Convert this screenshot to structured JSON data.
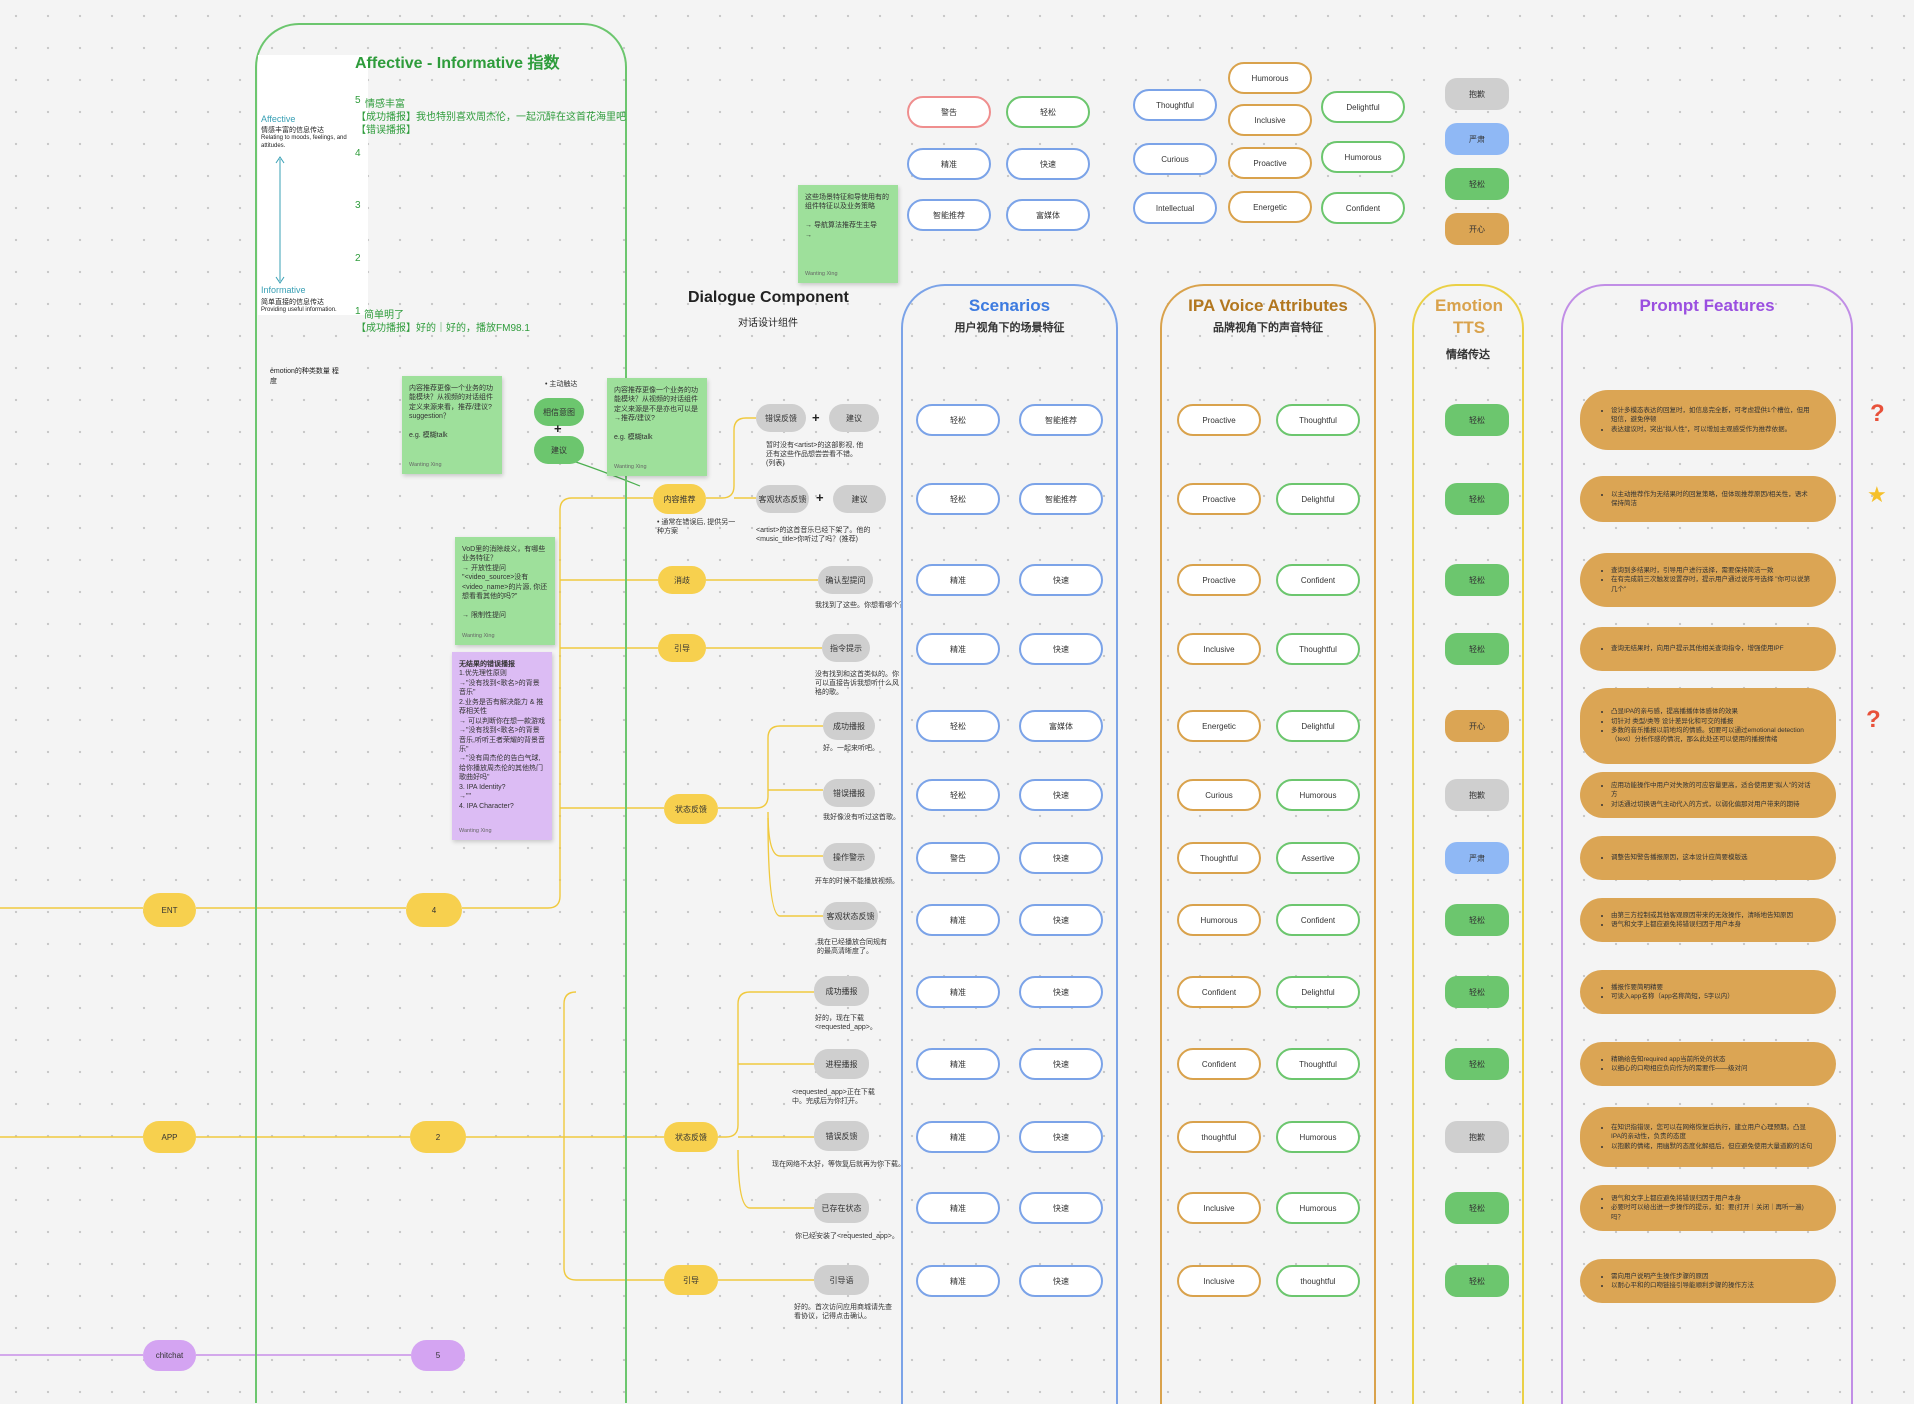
{
  "palette": {
    "yellow": "#f7d04e",
    "green_lane": "#6cc66e",
    "blue_lane": "#7ba3e8",
    "orange_lane": "#d9a24c",
    "gold_lane": "#ead046",
    "purple_lane": "#c18ee6",
    "red": "#e8513a"
  },
  "affective": {
    "title": "Affective - Informative 指数",
    "top_label": "Affective",
    "top_desc1": "情感丰富的信息传达",
    "top_desc2": "Relating to moods, feelings, and attitudes.",
    "bottom_label": "Informative",
    "bottom_desc1": "简单直接的信息传达",
    "bottom_desc2": "Providing useful information.",
    "level5_num": "5",
    "level5_title": "情感丰富",
    "level5_line1": "【成功播报】我也特别喜欢周杰伦，一起沉醉在这首花海里吧",
    "level5_line2": "【错误播报】",
    "level4": "4",
    "level3": "3",
    "level2": "2",
    "level1_num": "1",
    "level1_title": "简单明了",
    "level1_line1": "【成功播报】好的｜好的，播放FM98.1",
    "emotion_note": "emotion的种类数量 程度"
  },
  "dialogue": {
    "title": "Dialogue Component",
    "subtitle": "对话设计组件"
  },
  "notes": {
    "n1": "内容推荐更像一个业务的功能模块？从视频的对话组件定义来源来看，推荐/建议?suggestion？\n\ne.g. 模糊talk",
    "n1_author": "Wanting Xing",
    "n2": "内容推荐更像一个业务的功能模块？从视频的对话组件定义来源是不是亦也可以是→推荐/建议?\n\ne.g. 模糊talk",
    "n2_author": "Wanting Xing",
    "n3": "这些场景特征和导使用有的组件特征以及业务策略\n\n→ 导航算法推荐生主导\n→",
    "n3_author": "Wanting Xing",
    "n4": "VoD里的消除歧义，有哪些业务特征？\n→ 开放性提问\n\"<video_source>没有<video_name>的片源, 你还想看看其他的吗?\"\n\n→ 限制性提问",
    "n4_author": "Wanting Xing",
    "n5_title": "无结果的错误播报",
    "n5": "1.优先理性原则\n→\"没有找到<歌名>的背景音乐\"\n2.业务是否有解决能力 & 推荐相关性\n→ 可以判断你在想一款游戏\n→\"没有找到<歌名>的背景音乐,听听王者荣耀的背景音乐\"\n→\"没有周杰伦的告白气球, 给你播放周杰伦的其他热门歌曲好吗\"\n3. IPA Identity?\n→\"\"\n4. IPA Character?",
    "n5_author": "Wanting Xing"
  },
  "small_nodes": {
    "active": "• 主动触达",
    "intent": "相信意图",
    "plus": "+",
    "suggest": "建议",
    "content_recommend": "内容推荐",
    "content_caption": "• 通常在错误后, 提供另一种方案",
    "rc_fail": "错误反馈",
    "rc_suggest": "建议",
    "rc_caption": "暂时没有<artist>的这部影视, 他还有这些作品想尝尝看不错。(列表)",
    "rc2_fail": "客观状态反馈",
    "rc2_suggest": "建议",
    "rc2_caption": "<artist>的这首音乐已经下架了。他的<music_title>你听过了吗？(推荐)",
    "disambig": "消歧",
    "confirm": "确认型提问",
    "confirm_caption": "我找到了这些。你想看哪个？",
    "guide": "引导",
    "guide_tip": "指令提示",
    "guide_caption": "没有找到和这首类似的。你可以直接告诉我想听什么风格的歌。",
    "status": "状态反馈",
    "s1": "成功播报",
    "s1_caption": "好。一起来听吧。",
    "s2": "错误播报",
    "s2_caption": "我好像没有听过这首歌。",
    "s3": "操作警示",
    "s3_caption": "开车的时候不能播放视频。",
    "s4": "客观状态反馈",
    "s4_caption": "我在已经播放合同规有的最高清晰度了。",
    "a1": "成功播报",
    "a1_caption": "好的，现在下载<requested_app>。",
    "a2": "进程播报",
    "a2_caption": "<requested_app>正在下载中。完成后为你打开。",
    "a3": "错误反馈",
    "a3_caption": "现在网络不太好，等恢复后就再为你下载。",
    "a4": "已存在状态",
    "a4_caption": "你已经安装了<requested_app>。",
    "a_status": "状态反馈",
    "a_guide": "引导",
    "a5": "引导语",
    "a5_caption": "好的。首次访问应用商城请先查看协议，记得点击确认。",
    "ent": "ENT",
    "ent_num": "4",
    "app": "APP",
    "app_num": "2",
    "chitchat": "chitchat",
    "chitchat_num": "5"
  },
  "legend_pills": {
    "red1": "警告",
    "green1": "轻松",
    "blue1": "精准",
    "blue2": "快速",
    "blue3": "智能推荐",
    "blue4": "富媒体",
    "voice": [
      "Thoughtful",
      "Curious",
      "Intellectual",
      "Humorous",
      "Inclusive",
      "Proactive",
      "Energetic",
      "Delightful",
      "Humorous",
      "Confident"
    ],
    "emo": [
      "抱歉",
      "严肃",
      "轻松",
      "开心"
    ]
  },
  "lanes": {
    "scenarios_title": "Scenarios",
    "scenarios_sub": "用户视角下的场景特征",
    "ipa_title": "IPA Voice Attributes",
    "ipa_sub": "品牌视角下的声音特征",
    "emotion_title": "Emotion TTS",
    "emotion_sub": "情绪传达",
    "prompt_title": "Prompt Features"
  },
  "rows": [
    {
      "s1": "轻松",
      "s2": "智能推荐",
      "v1": "Proactive",
      "v2": "Thoughtful",
      "emo": "轻松",
      "pf": [
        "设计多模态表达的回复时，如信息完全断，可考虑提供1个槽位，但用短信，避免停顿",
        "表达建议时，突出\"拟人性\"，可以增加主观感受作为推荐依据。"
      ]
    },
    {
      "s1": "轻松",
      "s2": "智能推荐",
      "v1": "Proactive",
      "v2": "Delightful",
      "emo": "轻松",
      "pf": [
        "以主动推荐作为无结果时的回复策略，但体现推荐原因/相关性，语术保持简洁"
      ]
    },
    {
      "s1": "精准",
      "s2": "快速",
      "v1": "Proactive",
      "v2": "Confident",
      "emo": "轻松",
      "pf": [
        "查询到多结果时，引导用户进行选择，需要保持简洁一致",
        "在有完成前三次触发设置存时，提示用户通过说序号选择 \"你可以说第几个\""
      ]
    },
    {
      "s1": "精准",
      "s2": "快速",
      "v1": "Inclusive",
      "v2": "Thoughtful",
      "emo": "轻松",
      "pf": [
        "查询无结果时，向用户提示其他相关查询指令，增强使用IPF"
      ]
    },
    {
      "s1": "轻松",
      "s2": "富媒体",
      "v1": "Energetic",
      "v2": "Delightful",
      "emo": "开心",
      "pf": [
        "凸显IPA的亲与感，提高播播体体感体的效果",
        "切针对 类型/类等 设计差异化和可交的播报",
        "多数的音乐播报以前地均的情感。如要可以通过emotional detection（text）分析作感的情况，那么此处还可以使用的播报情绪"
      ]
    },
    {
      "s1": "轻松",
      "s2": "快速",
      "v1": "Curious",
      "v2": "Humorous",
      "emo": "抱歉",
      "pf": [
        "应用功能操作中用户对失败的可应容量更高，适合使用更\"拟人\"的对话方",
        "对话通过切换语气主动代入的方式，以弱化偏那对用户带来的期待"
      ]
    },
    {
      "s1": "警告",
      "s2": "快速",
      "v1": "Thoughtful",
      "v2": "Assertive",
      "emo": "严肃",
      "pf": [
        "调整告知警告播报原因，这本设计应简要模版选"
      ]
    },
    {
      "s1": "精准",
      "s2": "快速",
      "v1": "Humorous",
      "v2": "Confident",
      "emo": "轻松",
      "pf": [
        "由第三方控制或其他客观原因带来的无效操作，清晰地告知原因",
        "语气和文字上都应避免将错误归因于用户本身"
      ]
    },
    {
      "s1": "精准",
      "s2": "快速",
      "v1": "Confident",
      "v2": "Delightful",
      "emo": "轻松",
      "pf": [
        "播报作要简明精要",
        "可读入app名称（app名称简短，5字以内）"
      ]
    },
    {
      "s1": "精准",
      "s2": "快速",
      "v1": "Confident",
      "v2": "Thoughtful",
      "emo": "轻松",
      "pf": [
        "精确给告知required app当前所处的状态",
        "以细心的口吻相应负向作为的需要作——级对问"
      ]
    },
    {
      "s1": "精准",
      "s2": "快速",
      "v1": "thoughtful",
      "v2": "Humorous",
      "emo": "抱歉",
      "pf": [
        "在知识指错误，您可以在网络恢复后执行，建立用户心理预期。凸显IPA的亲动性，负责的态度",
        "以抱歉的情绪，用幽默的态度化解组后，但应避免使用大量道歉的话句"
      ]
    },
    {
      "s1": "精准",
      "s2": "快速",
      "v1": "Inclusive",
      "v2": "Humorous",
      "emo": "轻松",
      "pf": [
        "语气和文字上都应避免将错误归因于用户本身",
        "必要时可以给出进一步操作的提示，如：要(打开｜关闭｜再听一遍)吗？"
      ]
    },
    {
      "s1": "精准",
      "s2": "快速",
      "v1": "Inclusive",
      "v2": "thoughtful",
      "emo": "轻松",
      "pf": [
        "需向用户说明产生操作步骤的原因",
        "以耐心平和的口吻链接引导能顺利步骤的操作方法"
      ]
    }
  ],
  "side_marks": {
    "q1": "?",
    "star": "★",
    "q2": "?"
  }
}
